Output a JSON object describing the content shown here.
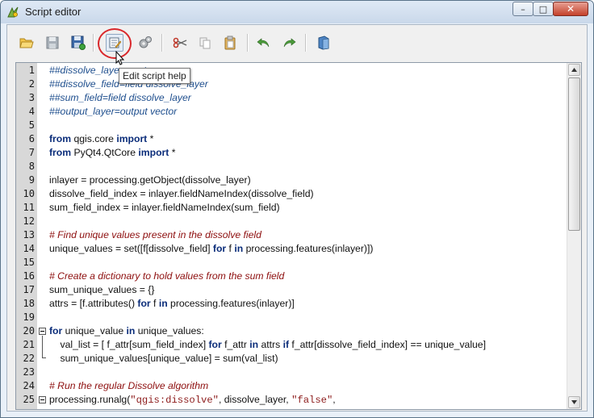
{
  "window": {
    "title": "Script editor"
  },
  "title_buttons": {
    "minimize": "–",
    "maximize": "□",
    "close": "✕"
  },
  "toolbar": [
    {
      "name": "open-script-button",
      "icon": "folder-open-icon"
    },
    {
      "name": "save-script-button",
      "icon": "save-icon"
    },
    {
      "name": "save-as-button",
      "icon": "save-as-icon"
    },
    {
      "name": "edit-script-help-button",
      "icon": "edit-help-icon"
    },
    {
      "name": "run-script-button",
      "icon": "gears-icon"
    },
    {
      "name": "cut-button",
      "icon": "scissors-icon"
    },
    {
      "name": "copy-button",
      "icon": "copy-icon"
    },
    {
      "name": "paste-button",
      "icon": "paste-icon"
    },
    {
      "name": "undo-button",
      "icon": "undo-icon"
    },
    {
      "name": "redo-button",
      "icon": "redo-icon"
    },
    {
      "name": "snippets-button",
      "icon": "book-icon"
    }
  ],
  "tooltip": "Edit script help",
  "colors": {
    "comment": "#8d0e0e",
    "keyword": "#0b2d7a",
    "string": "#8c1a1a",
    "gutter": "#d8d8d8",
    "highlight_ring": "#d9272b"
  },
  "editor": {
    "lines": [
      {
        "n": "1",
        "parts": [
          {
            "t": "##dissolve_layer=vector",
            "c": "cm2"
          }
        ]
      },
      {
        "n": "2",
        "parts": [
          {
            "t": "##dissolve_field=field dissolve_layer",
            "c": "cm2"
          }
        ]
      },
      {
        "n": "3",
        "parts": [
          {
            "t": "##sum_field=field dissolve_layer",
            "c": "cm2"
          }
        ]
      },
      {
        "n": "4",
        "parts": [
          {
            "t": "##output_layer=output vector",
            "c": "cm2"
          }
        ]
      },
      {
        "n": "5",
        "parts": []
      },
      {
        "n": "6",
        "parts": [
          {
            "t": "from",
            "c": "kw"
          },
          {
            "t": " qgis.core "
          },
          {
            "t": "import",
            "c": "kw"
          },
          {
            "t": " *"
          }
        ]
      },
      {
        "n": "7",
        "parts": [
          {
            "t": "from",
            "c": "kw"
          },
          {
            "t": " PyQt4.QtCore "
          },
          {
            "t": "import",
            "c": "kw"
          },
          {
            "t": " *"
          }
        ]
      },
      {
        "n": "8",
        "parts": []
      },
      {
        "n": "9",
        "parts": [
          {
            "t": "inlayer = processing.getObject(dissolve_layer)"
          }
        ]
      },
      {
        "n": "10",
        "parts": [
          {
            "t": "dissolve_field_index = inlayer.fieldNameIndex(dissolve_field)"
          }
        ]
      },
      {
        "n": "11",
        "parts": [
          {
            "t": "sum_field_index = inlayer.fieldNameIndex(sum_field)"
          }
        ]
      },
      {
        "n": "12",
        "parts": []
      },
      {
        "n": "13",
        "parts": [
          {
            "t": "# Find unique values present in the dissolve field",
            "c": "cm"
          }
        ]
      },
      {
        "n": "14",
        "parts": [
          {
            "t": "unique_values = set([f[dissolve_field] "
          },
          {
            "t": "for",
            "c": "kw"
          },
          {
            "t": " f "
          },
          {
            "t": "in",
            "c": "kw"
          },
          {
            "t": " processing.features(inlayer)])"
          }
        ]
      },
      {
        "n": "15",
        "parts": []
      },
      {
        "n": "16",
        "parts": [
          {
            "t": "# Create a dictionary to hold values from the sum field",
            "c": "cm"
          }
        ]
      },
      {
        "n": "17",
        "parts": [
          {
            "t": "sum_unique_values = {}"
          }
        ]
      },
      {
        "n": "18",
        "parts": [
          {
            "t": "attrs = [f.attributes() "
          },
          {
            "t": "for",
            "c": "kw"
          },
          {
            "t": " f "
          },
          {
            "t": "in",
            "c": "kw"
          },
          {
            "t": " processing.features(inlayer)]"
          }
        ]
      },
      {
        "n": "19",
        "parts": []
      },
      {
        "n": "20",
        "parts": [
          {
            "t": "for",
            "c": "kw"
          },
          {
            "t": " unique_value "
          },
          {
            "t": "in",
            "c": "kw"
          },
          {
            "t": " unique_values:"
          }
        ]
      },
      {
        "n": "21",
        "parts": [
          {
            "t": "    val_list = [ f_attr[sum_field_index] "
          },
          {
            "t": "for",
            "c": "kw"
          },
          {
            "t": " f_attr "
          },
          {
            "t": "in",
            "c": "kw"
          },
          {
            "t": " attrs "
          },
          {
            "t": "if",
            "c": "kw"
          },
          {
            "t": " f_attr[dissolve_field_index] == unique_value]"
          }
        ]
      },
      {
        "n": "22",
        "parts": [
          {
            "t": "    sum_unique_values[unique_value] = sum(val_list)"
          }
        ]
      },
      {
        "n": "23",
        "parts": []
      },
      {
        "n": "24",
        "parts": [
          {
            "t": "# Run the regular Dissolve algorithm",
            "c": "cm"
          }
        ]
      },
      {
        "n": "25",
        "parts": [
          {
            "t": "processing.runalg("
          },
          {
            "t": "\"qgis:dissolve\"",
            "c": "str"
          },
          {
            "t": ", dissolve_layer, "
          },
          {
            "t": "\"false\"",
            "c": "str"
          },
          {
            "t": ","
          }
        ]
      }
    ]
  }
}
